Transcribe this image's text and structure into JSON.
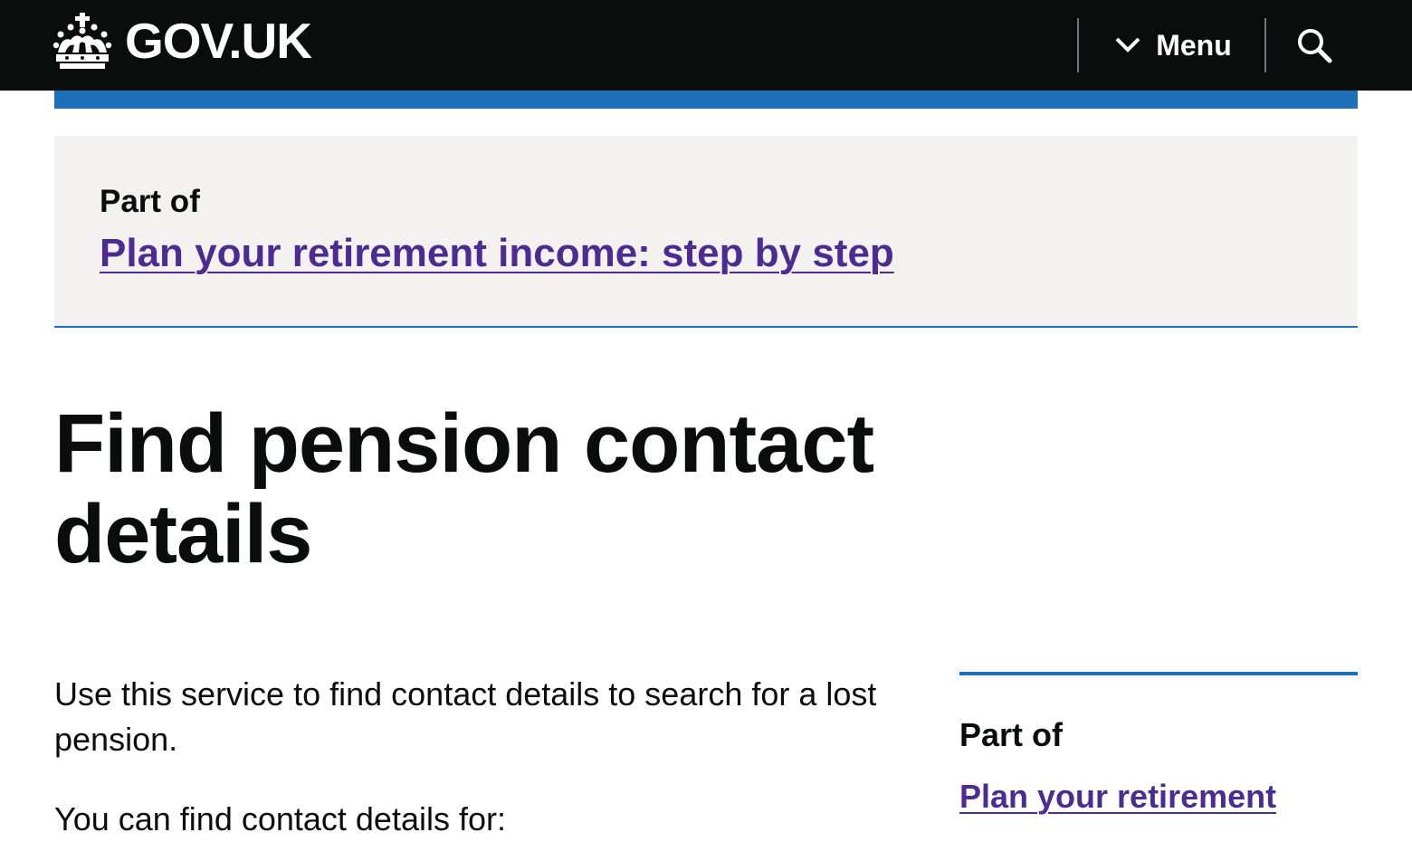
{
  "header": {
    "logo_text": "GOV.UK",
    "logo_icon": "crown-icon",
    "menu_label": "Menu",
    "menu_icon": "chevron-down-icon",
    "search_icon": "search-icon"
  },
  "step_nav": {
    "part_of_label": "Part of",
    "link_text": "Plan your retirement income: step by step"
  },
  "main": {
    "title": "Find pension contact details",
    "intro": "Use this service to find contact details to search for a lost pension.",
    "subintro": "You can find contact details for:"
  },
  "sidebar": {
    "part_of_label": "Part of",
    "link_text": "Plan your retirement"
  },
  "colors": {
    "header_bg": "#0b0c0c",
    "brand_blue": "#1d70b8",
    "link_purple": "#4c2c92",
    "panel_grey": "#f3f2f1",
    "text": "#0b0c0c"
  }
}
